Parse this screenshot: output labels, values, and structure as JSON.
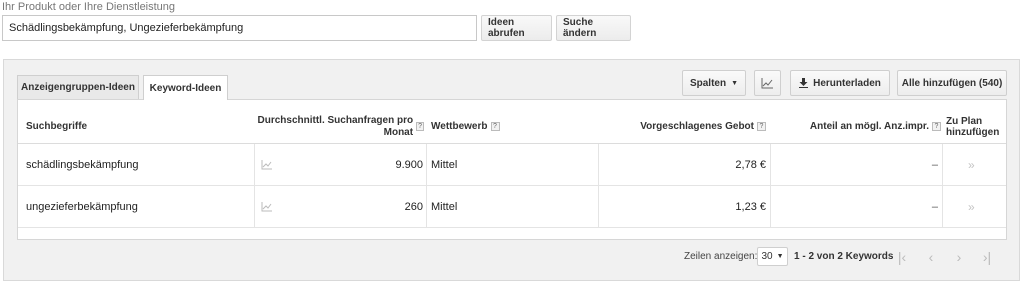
{
  "search": {
    "label": "Ihr Produkt oder Ihre Dienstleistung",
    "value": "Schädlingsbekämpfung, Ungezieferbekämpfung",
    "ideas_button": "Ideen abrufen",
    "modify_button": "Suche ändern"
  },
  "tabs": [
    {
      "label": "Anzeigengruppen-Ideen",
      "active": false
    },
    {
      "label": "Keyword-Ideen",
      "active": true
    }
  ],
  "toolbar": {
    "columns_label": "Spalten",
    "download_label": "Herunterladen",
    "add_all_label": "Alle hinzufügen (540)",
    "chart_icon": "chart-icon"
  },
  "table": {
    "headers": {
      "keyword": "Suchbegriffe",
      "avg_searches": "Durchschnittl. Suchanfragen pro Monat",
      "competition": "Wettbewerb",
      "suggested_bid": "Vorgeschlagenes Gebot",
      "impression_share": "Anteil an mögl. Anz.impr.",
      "add_to_plan": "Zu Plan hinzufügen"
    },
    "help_glyph": "?",
    "rows": [
      {
        "keyword": "schädlingsbekämpfung",
        "searches": "9.900",
        "competition": "Mittel",
        "bid": "2,78 €",
        "share": "–",
        "add": "»"
      },
      {
        "keyword": "ungezieferbekämpfung",
        "searches": "260",
        "competition": "Mittel",
        "bid": "1,23 €",
        "share": "–",
        "add": "»"
      }
    ]
  },
  "footer": {
    "rows_label": "Zeilen anzeigen:",
    "rows_value": "30",
    "range_text": "1 - 2 von 2 Keywords"
  },
  "colors": {
    "border": "#d6d6d6",
    "panel_bg": "#f1f1f1",
    "button_bg": "#ececec"
  }
}
